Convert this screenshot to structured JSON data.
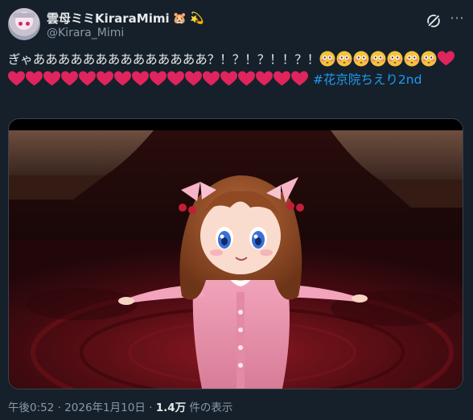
{
  "author": {
    "display_name": "雲母ミミKiraraMimi",
    "handle": "@Kirara_Mimi",
    "name_emoji_1": "🐹",
    "name_emoji_2": "💫"
  },
  "tweet": {
    "text": "ぎゃああああああああああああああ？！？！？！！？！",
    "hashtag_text": "#花京院ちえり2nd",
    "flushed_face_count": 7,
    "heart_count": 18,
    "emoji_face": "flushed-face",
    "emoji_heart": "red-heart"
  },
  "media": {
    "kind": "video-thumbnail",
    "subject": "3D anime girl character in pink outfit"
  },
  "meta": {
    "timestamp": "午後0:52 · 2026年1月10日",
    "separator": " · ",
    "views_count": "1.4万",
    "views_suffix": " 件の表示"
  },
  "colors": {
    "background": "#15202b",
    "text": "#e7e9ea",
    "muted": "#8b98a5",
    "link": "#1d9bf0",
    "heart": "#e0245e"
  },
  "icons": {
    "grok": "grok-icon",
    "more": "more-icon"
  }
}
